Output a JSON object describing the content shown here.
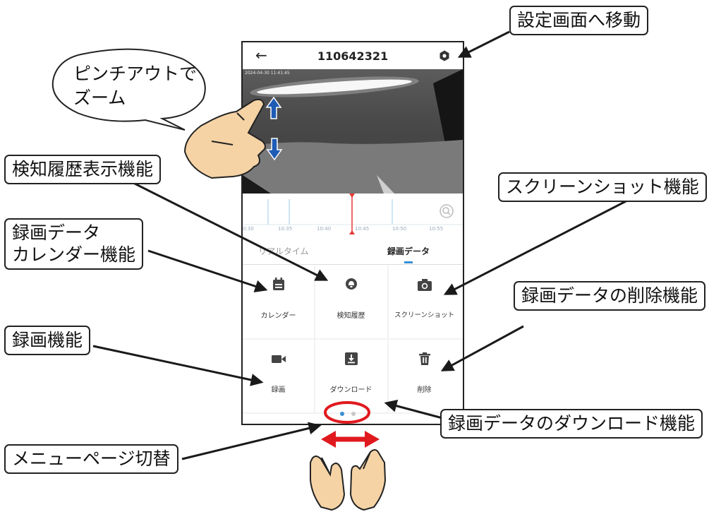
{
  "app": {
    "title": "110642321",
    "back_icon": "back-arrow-icon",
    "settings_icon": "gear-icon"
  },
  "video": {
    "timestamp": "2024-04-30 11:41:45"
  },
  "timeline": {
    "ticks": [
      "0:30",
      "10:35",
      "10:40",
      "10:45",
      "10:50",
      "10:55"
    ],
    "zoom_icon": "zoom-icon"
  },
  "tabs": [
    {
      "label": "リアルタイム",
      "active": false
    },
    {
      "label": "録画データ",
      "active": true
    }
  ],
  "menu": [
    {
      "label": "カレンダー",
      "icon": "calendar-icon"
    },
    {
      "label": "検知履歴",
      "icon": "bell-icon"
    },
    {
      "label": "スクリーンショット",
      "icon": "camera-icon"
    },
    {
      "label": "録画",
      "icon": "video-camera-icon"
    },
    {
      "label": "ダウンロード",
      "icon": "download-icon"
    },
    {
      "label": "削除",
      "icon": "trash-icon"
    }
  ],
  "pager": {
    "pages": 2,
    "current": 1
  },
  "speech_bubble": {
    "line1": "ピンチアウトで",
    "line2": "ズーム"
  },
  "callouts": {
    "settings": "設定画面へ移動",
    "history": "検知履歴表示機能",
    "calendar_line1": "録画データ",
    "calendar_line2": "カレンダー機能",
    "screenshot": "スクリーンショット機能",
    "delete": "録画データの削除機能",
    "record": "録画機能",
    "download": "録画データのダウンロード機能",
    "page_switch": "メニューページ切替"
  },
  "colors": {
    "accent": "#3a8fd6",
    "playhead": "#e53935",
    "annotation_red": "#e0191e",
    "arrow_blue": "#1f5bb5",
    "hand_skin": "#f5d3a5"
  }
}
